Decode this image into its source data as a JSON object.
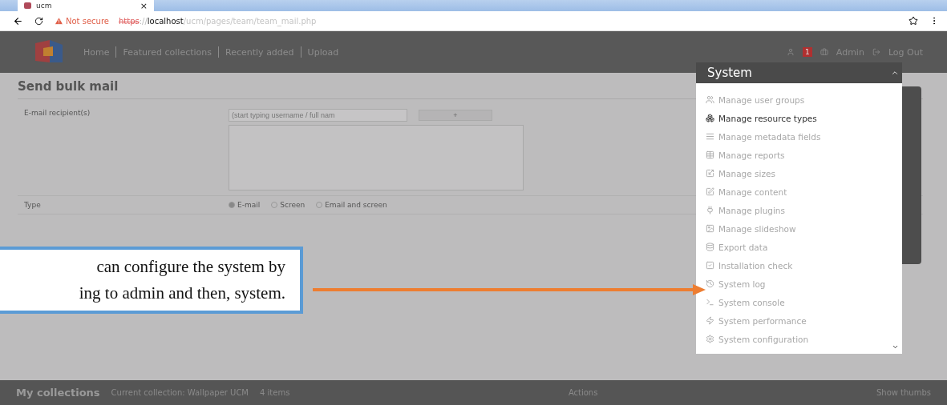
{
  "browser": {
    "tab": {
      "title": "ucm",
      "close": "×"
    },
    "address": {
      "warning": "Not secure",
      "scheme": "https",
      "separator": "://",
      "host": "localhost",
      "path": "/ucm/pages/team/team_mail.php"
    }
  },
  "header": {
    "nav": [
      "Home",
      "Featured collections",
      "Recently added",
      "Upload"
    ],
    "badge": "1",
    "admin": "Admin",
    "logout": "Log Out"
  },
  "form": {
    "title": "Send bulk mail",
    "recipients": {
      "label": "E-mail recipient(s)",
      "placeholder": "(start typing username / full nam",
      "button": "+"
    },
    "type": {
      "label": "Type",
      "options": [
        {
          "label": "E-mail",
          "selected": true
        },
        {
          "label": "Screen",
          "selected": false
        },
        {
          "label": "Email and screen",
          "selected": false
        }
      ]
    }
  },
  "menu": {
    "title": "System",
    "items": [
      {
        "label": "Manage user groups",
        "selected": false
      },
      {
        "label": "Manage resource types",
        "selected": true
      },
      {
        "label": "Manage metadata fields",
        "selected": false
      },
      {
        "label": "Manage reports",
        "selected": false
      },
      {
        "label": "Manage sizes",
        "selected": false
      },
      {
        "label": "Manage content",
        "selected": false
      },
      {
        "label": "Manage plugins",
        "selected": false
      },
      {
        "label": "Manage slideshow",
        "selected": false
      },
      {
        "label": "Export data",
        "selected": false
      },
      {
        "label": "Installation check",
        "selected": false
      },
      {
        "label": "System log",
        "selected": false
      },
      {
        "label": "System console",
        "selected": false
      },
      {
        "label": "System performance",
        "selected": false
      },
      {
        "label": "System configuration",
        "selected": false
      }
    ]
  },
  "footer": {
    "title": "My collections",
    "current": "Current collection: Wallpaper UCM",
    "count": "4 items",
    "actions": "Actions",
    "thumbs": "Show thumbs"
  },
  "callout": {
    "lines": [
      "can configure the system by",
      "ing to admin and then, system."
    ]
  }
}
